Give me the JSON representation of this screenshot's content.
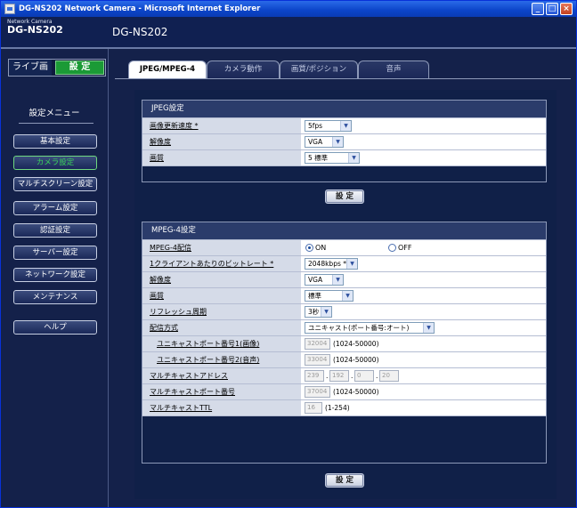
{
  "window": {
    "title": "DG-NS202 Network Camera - Microsoft Internet Explorer",
    "buttons": {
      "minimize": "_",
      "maximize": "□",
      "close": "×"
    }
  },
  "brand": {
    "line1": "Network Camera",
    "line2": "DG-NS202"
  },
  "model_name": "DG-NS202",
  "mode": {
    "live": "ライブ画",
    "setup": "設 定"
  },
  "menu": {
    "title": "設定メニュー",
    "items": [
      {
        "label": "基本設定",
        "active": false
      },
      {
        "label": "カメラ設定",
        "active": true
      },
      {
        "label": "マルチスクリーン設定",
        "active": false
      },
      {
        "label": "アラーム設定",
        "active": false
      },
      {
        "label": "認証設定",
        "active": false
      },
      {
        "label": "サーバー設定",
        "active": false
      },
      {
        "label": "ネットワーク設定",
        "active": false
      },
      {
        "label": "メンテナンス",
        "active": false
      }
    ],
    "help": "ヘルプ"
  },
  "tabs": [
    {
      "label": "JPEG/MPEG-4",
      "active": true
    },
    {
      "label": "カメラ動作",
      "active": false
    },
    {
      "label": "画質/ポジション",
      "active": false
    },
    {
      "label": "音声",
      "active": false
    }
  ],
  "jpeg": {
    "header": "JPEG設定",
    "rows": [
      {
        "label": "画像更新速度 *",
        "value": "5fps"
      },
      {
        "label": "解像度",
        "value": "VGA"
      },
      {
        "label": "画質",
        "value": "5 標準"
      }
    ],
    "set_button": "設 定"
  },
  "mpeg4": {
    "header": "MPEG-4設定",
    "delivery": {
      "label": "MPEG-4配信",
      "on": "ON",
      "off": "OFF",
      "selected": "ON"
    },
    "bitrate": {
      "label": "1クライアントあたりのビットレート *",
      "value": "2048kbps *"
    },
    "resolution": {
      "label": "解像度",
      "value": "VGA"
    },
    "quality": {
      "label": "画質",
      "value": "標準"
    },
    "refresh": {
      "label": "リフレッシュ周期",
      "value": "3秒"
    },
    "method": {
      "label": "配信方式",
      "value": "ユニキャスト(ポート番号:オート)"
    },
    "unicast_video": {
      "label": "ユニキャストポート番号1(画像)",
      "value": "32004",
      "range": "(1024-50000)"
    },
    "unicast_audio": {
      "label": "ユニキャストポート番号2(音声)",
      "value": "33004",
      "range": "(1024-50000)"
    },
    "multicast_addr": {
      "label": "マルチキャストアドレス",
      "octets": [
        "239",
        "192",
        "0",
        "20"
      ]
    },
    "multicast_port": {
      "label": "マルチキャストポート番号",
      "value": "37004",
      "range": "(1024-50000)"
    },
    "multicast_ttl": {
      "label": "マルチキャストTTL",
      "value": "16",
      "range": "(1-254)"
    },
    "set_button": "設 定"
  },
  "colors": {
    "navy": "#14214a",
    "panel_header": "#2b3c6b",
    "label_bg": "#d5dbe8",
    "active_green": "#1b9a36"
  }
}
